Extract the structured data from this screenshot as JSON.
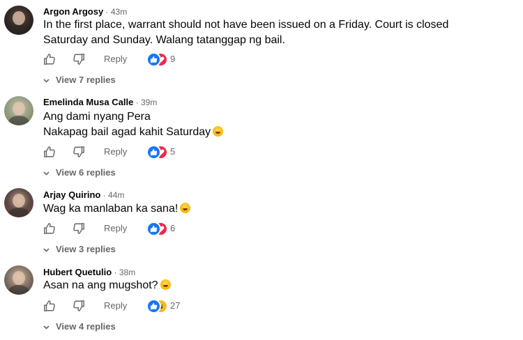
{
  "comments": [
    {
      "name": "Argon Argosy",
      "time": "43m",
      "lines": [
        "In the first place, warrant should not have been issued on a Friday. Court is closed",
        "Saturday and Sunday. Walang tatanggap ng bail."
      ],
      "reply_label": "Reply",
      "reactions": [
        "like",
        "love"
      ],
      "reaction_count": "9",
      "view_replies": "View 7 replies"
    },
    {
      "name": "Emelinda Musa Calle",
      "time": "39m",
      "lines": [
        "Ang dami nyang Pera",
        "Nakapag bail agad kahit Saturday"
      ],
      "reply_label": "Reply",
      "reactions": [
        "like",
        "love"
      ],
      "reaction_count": "5",
      "view_replies": "View 6 replies"
    },
    {
      "name": "Arjay Quirino",
      "time": "44m",
      "lines": [
        "Wag ka manlaban ka sana!"
      ],
      "reply_label": "Reply",
      "reactions": [
        "like",
        "love"
      ],
      "reaction_count": "6",
      "view_replies": "View 3 replies"
    },
    {
      "name": "Hubert Quetulio",
      "time": "38m",
      "lines": [
        "Asan na ang mugshot?"
      ],
      "reply_label": "Reply",
      "reactions": [
        "like",
        "haha"
      ],
      "reaction_count": "27",
      "view_replies": "View 4 replies"
    }
  ],
  "separator": " · ",
  "icons": {
    "like": "thumbs-up-outline-icon",
    "dislike": "thumbs-down-outline-icon",
    "chevron": "chevron-down-icon",
    "laugh_emoji": "rolling-on-floor-laughing-emoji"
  },
  "colors": {
    "name": "#050505",
    "meta": "#65676b",
    "like_reaction": "#1877f2",
    "love_reaction": "#f02849",
    "haha_reaction": "#f7b928"
  }
}
